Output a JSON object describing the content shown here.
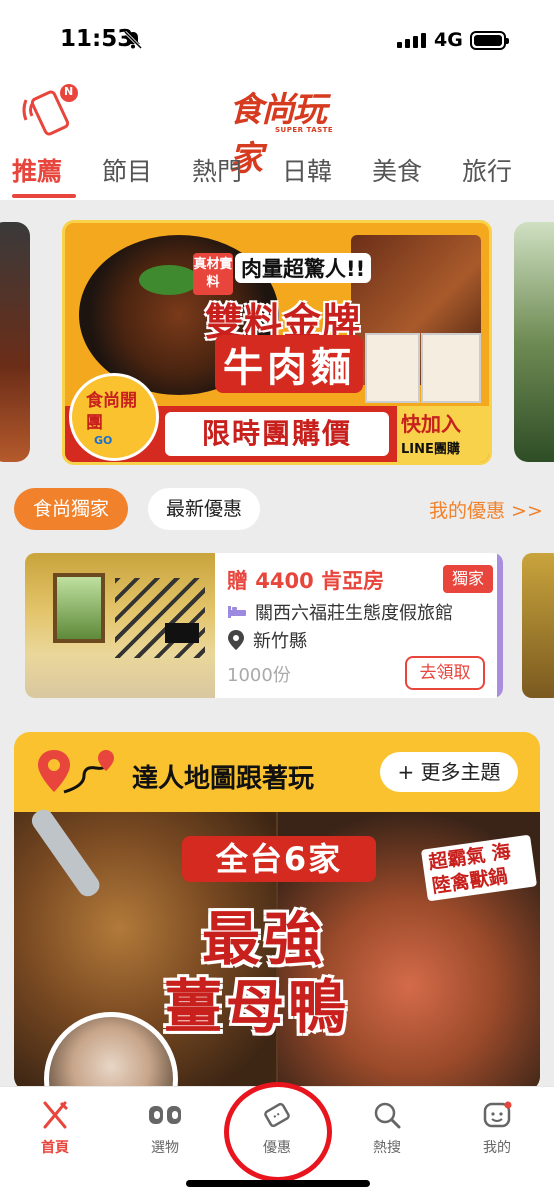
{
  "status_bar": {
    "time": "11:53",
    "network": "4G"
  },
  "header": {
    "logo_main": "食尚玩家",
    "logo_sub": "SUPER TASTE",
    "notification_badge": "N",
    "tabs": [
      {
        "label": "推薦",
        "active": true
      },
      {
        "label": "節目"
      },
      {
        "label": "熱門"
      },
      {
        "label": "日韓"
      },
      {
        "label": "美食"
      },
      {
        "label": "旅行"
      }
    ]
  },
  "banner": {
    "tag": "真材實料",
    "headline": "肉量超驚人!!",
    "title_line1": "雙料金牌",
    "title_line2": "牛肉麵",
    "go_badge": "食尚開團",
    "go_badge_sub": "GO",
    "group_buy": "限時團購價",
    "join_1": "快加入",
    "join_2": "LINE團購"
  },
  "deals": {
    "chip_active": "食尚獨家",
    "chip_normal": "最新優惠",
    "my_deals": "我的優惠 >>",
    "card": {
      "title": "贈 4400 肯亞房",
      "badge": "獨家",
      "venue": "關西六福莊生態度假旅館",
      "location": "新竹縣",
      "count": "1000份",
      "button": "去領取"
    }
  },
  "map_section": {
    "title": "達人地圖跟著玩",
    "more_button": "+ 更多主題",
    "img_line1": "全台6家",
    "img_line2": "最強",
    "img_line3": "薑母鴨",
    "img_side": "超霸氣 海陸禽獸鍋"
  },
  "bottom_nav": [
    {
      "label": "首頁",
      "icon": "fork-knife-icon",
      "active": true
    },
    {
      "label": "選物",
      "icon": "cc-icon"
    },
    {
      "label": "優惠",
      "icon": "ticket-icon"
    },
    {
      "label": "熱搜",
      "icon": "search-icon"
    },
    {
      "label": "我的",
      "icon": "profile-face-icon"
    }
  ],
  "colors": {
    "accent": "#e8453c",
    "orange": "#f1822b",
    "yellow": "#f9c22e",
    "highlight_ring": "#e8141e"
  }
}
